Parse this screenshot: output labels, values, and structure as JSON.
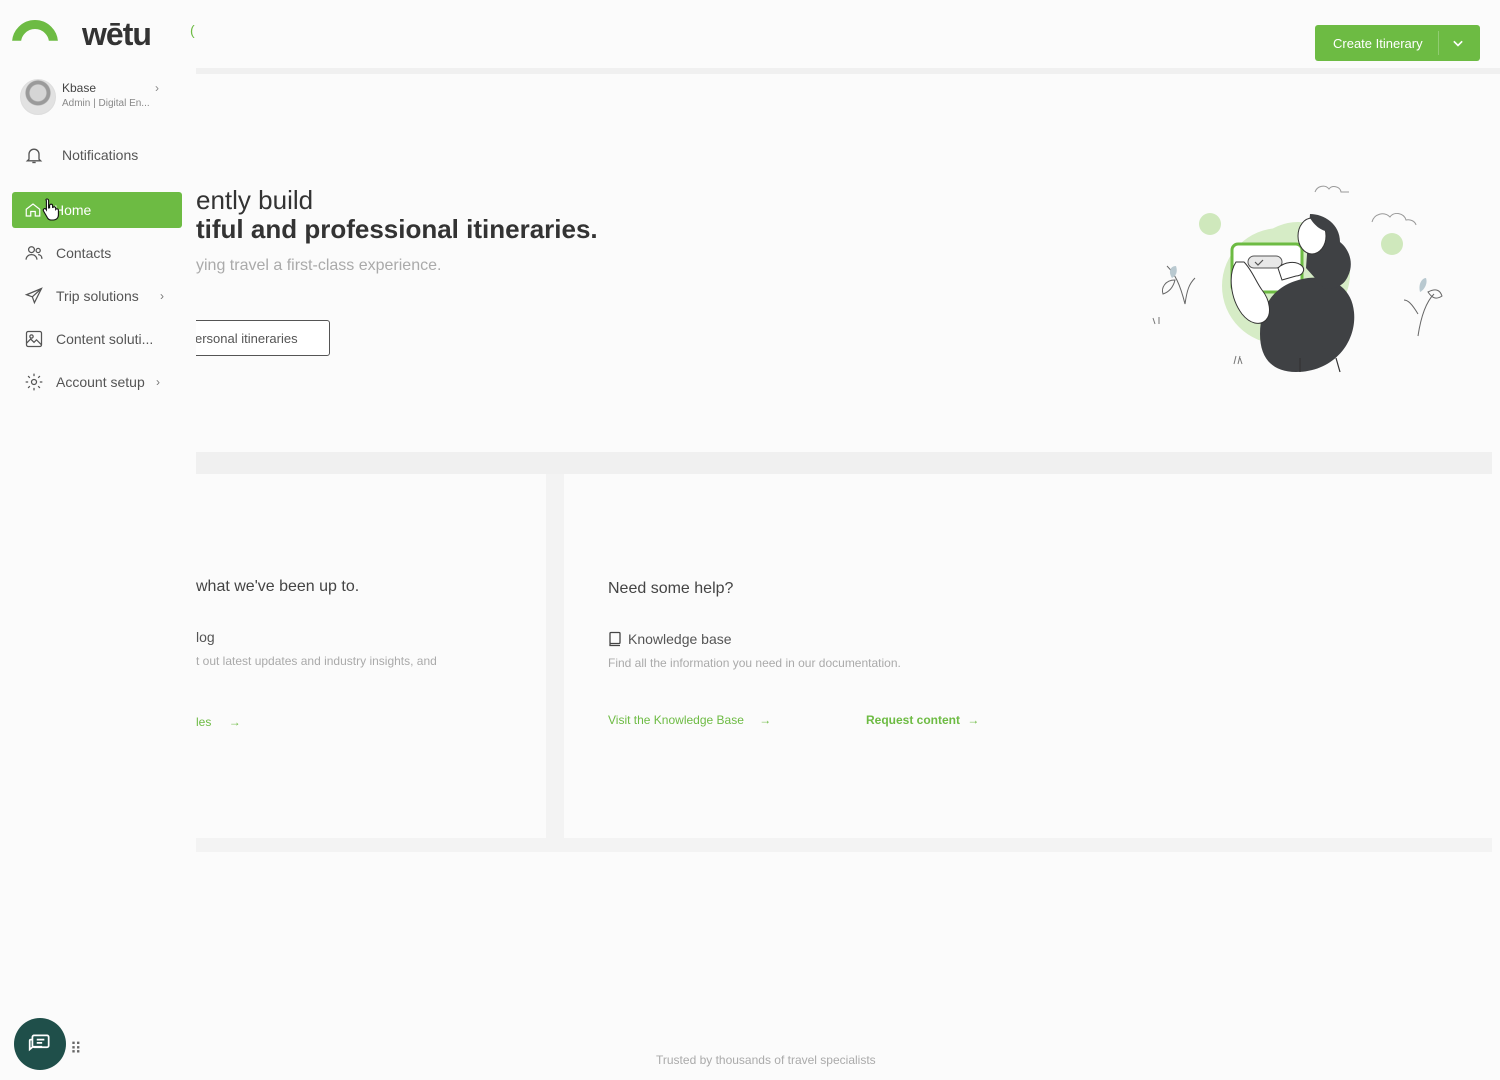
{
  "brand": {
    "name": "wētu",
    "accent": "#6dbb43"
  },
  "user": {
    "name": "Kbase",
    "role": "Admin | Digital En..."
  },
  "notifications": {
    "label": "Notifications"
  },
  "nav": {
    "items": [
      {
        "label": "Home",
        "icon": "home-icon",
        "active": true
      },
      {
        "label": "Contacts",
        "icon": "contacts-icon"
      },
      {
        "label": "Trip solutions",
        "icon": "send-icon",
        "chevron": "›"
      },
      {
        "label": "Content soluti...",
        "icon": "image-icon"
      },
      {
        "label": "Account setup",
        "icon": "gear-icon",
        "chevron": "›"
      }
    ]
  },
  "topbar": {
    "create_label": "Create Itinerary"
  },
  "hero": {
    "line1": "ently build",
    "line2": "tiful and professional itineraries.",
    "subtitle": "ying travel a first-class experience.",
    "button_label": "ersonal itineraries"
  },
  "cards": {
    "left": {
      "title": "what we've been up to.",
      "item_title": "log",
      "item_desc": "t out latest updates and industry insights, and",
      "link": "les"
    },
    "right": {
      "title": "Need some help?",
      "item_title": "Knowledge base",
      "item_desc": "Find all the information you need in our documentation.",
      "link_kb": "Visit the Knowledge Base",
      "link_request": "Request content"
    }
  },
  "footer": {
    "text": "Trusted by thousands of travel specialists"
  }
}
